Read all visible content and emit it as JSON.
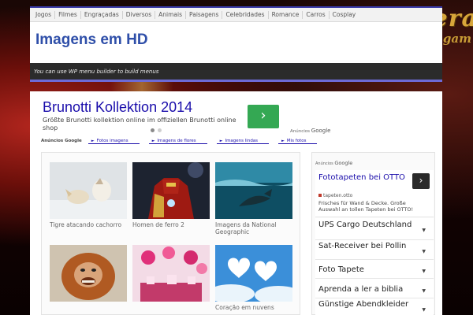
{
  "topnav": [
    "Jogos",
    "Filmes",
    "Engraçadas",
    "Diversos",
    "Animais",
    "Paisagens",
    "Celebridades",
    "Romance",
    "Carros",
    "Cosplay"
  ],
  "site": {
    "title": "Imagens em HD",
    "menu_notice": "You can use WP menu builder to build menus"
  },
  "ad": {
    "title": "Brunotti Kollektion 2014",
    "text": "Größte Brunotti kollektion online im offiziellen Brunotti online shop",
    "cta_icon": "chevron-right-icon",
    "cta_symbol": "›",
    "network_small": "Anúncios",
    "network": "Google",
    "cta_color": "#34a853"
  },
  "linkbar": {
    "label": "Anúncios Google",
    "links": [
      "Fotos imagens",
      "Imagens de flores",
      "Imagens lindas",
      "Mis fotos"
    ]
  },
  "gallery": [
    {
      "caption": "Tigre atacando cachorro"
    },
    {
      "caption": "Homen de ferro 2"
    },
    {
      "caption": "Imagens da National Geographic"
    },
    {
      "caption": ""
    },
    {
      "caption": ""
    },
    {
      "caption": "Coração em nuvens"
    }
  ],
  "sidebar": {
    "network_small": "Anúncios",
    "network": "Google",
    "featured": {
      "title": "Fototapeten bei OTTO",
      "url": "tapeten.otto",
      "text": "Frisches für Wand & Decke. Große Auswahl an tollen Tapeten bei OTTO!",
      "cta_symbol": "›"
    },
    "items": [
      {
        "label": "UPS Cargo Deutschland"
      },
      {
        "label": "Sat-Receiver bei Pollin"
      },
      {
        "label": "Foto Tapete"
      },
      {
        "label": "Aprenda a ler a biblia"
      },
      {
        "label": "Günstige Abendkleider"
      }
    ]
  }
}
